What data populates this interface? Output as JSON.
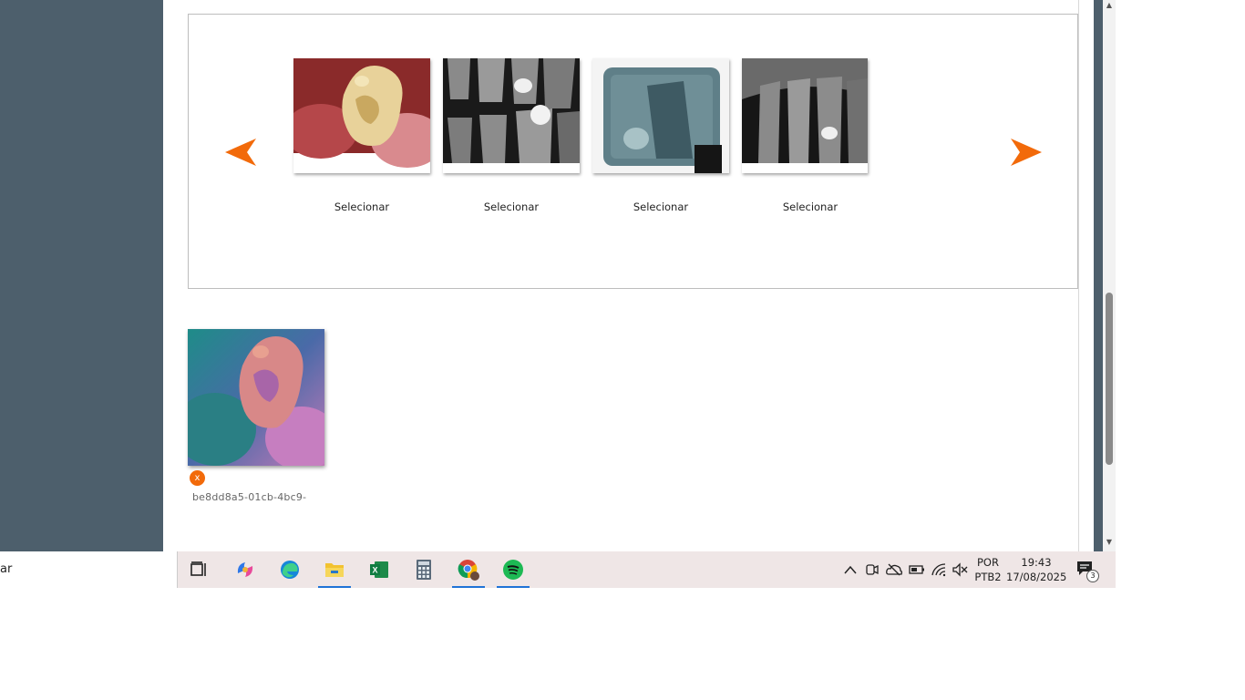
{
  "carousel": {
    "items": [
      {
        "label": "Selecionar"
      },
      {
        "label": "Selecionar"
      },
      {
        "label": "Selecionar"
      },
      {
        "label": "Selecionar"
      }
    ],
    "accent_color": "#f26a0a"
  },
  "selected_image": {
    "file_name": "be8dd8a5-01cb-4bc9-",
    "remove_label": "x"
  },
  "taskbar": {
    "search_text": "ar",
    "apps": [
      "task-view-icon",
      "copilot-icon",
      "edge-icon",
      "file-explorer-icon",
      "excel-icon",
      "calculator-icon",
      "chrome-icon",
      "spotify-icon"
    ],
    "lang_top": "POR",
    "lang_bottom": "PTB2",
    "time": "19:43",
    "date": "17/08/2025",
    "notification_count": "3"
  }
}
